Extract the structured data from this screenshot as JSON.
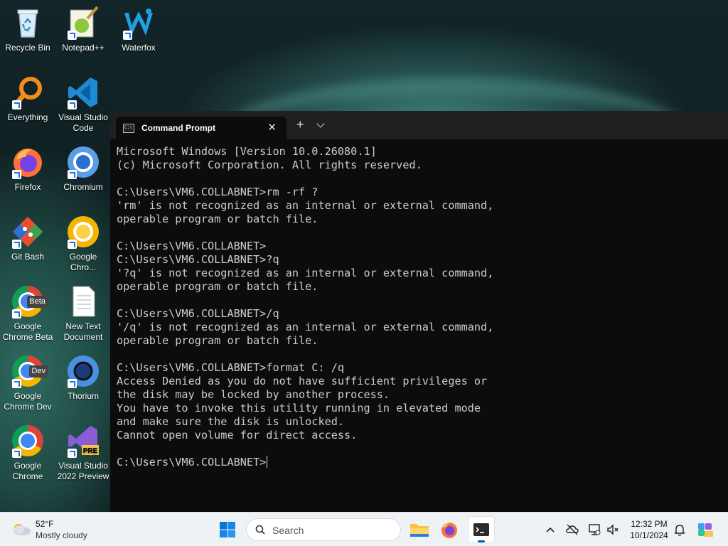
{
  "desktop": {
    "icons": [
      {
        "label": "Recycle Bin"
      },
      {
        "label": "Notepad++"
      },
      {
        "label": "Waterfox"
      },
      {
        "label": "Everything"
      },
      {
        "label": "Visual Studio Code"
      },
      {
        "label": "Firefox"
      },
      {
        "label": "Chromium"
      },
      {
        "label": "Git Bash"
      },
      {
        "label": "Google Chro..."
      },
      {
        "label": "Google Chrome Beta",
        "badge": "Beta"
      },
      {
        "label": "New Text Document"
      },
      {
        "label": "Google Chrome Dev",
        "badge": "Dev"
      },
      {
        "label": "Thorium"
      },
      {
        "label": "Google Chrome"
      },
      {
        "label": "Visual Studio 2022 Preview",
        "badge": "PRE"
      }
    ]
  },
  "terminal": {
    "tab_title": "Command Prompt",
    "close_glyph": "✕",
    "new_tab_glyph": "+",
    "lines": [
      "Microsoft Windows [Version 10.0.26080.1]",
      "(c) Microsoft Corporation. All rights reserved.",
      "",
      "C:\\Users\\VM6.COLLABNET>rm -rf ?",
      "'rm' is not recognized as an internal or external command,",
      "operable program or batch file.",
      "",
      "C:\\Users\\VM6.COLLABNET>",
      "C:\\Users\\VM6.COLLABNET>?q",
      "'?q' is not recognized as an internal or external command,",
      "operable program or batch file.",
      "",
      "C:\\Users\\VM6.COLLABNET>/q",
      "'/q' is not recognized as an internal or external command,",
      "operable program or batch file.",
      "",
      "C:\\Users\\VM6.COLLABNET>format C: /q",
      "Access Denied as you do not have sufficient privileges or",
      "the disk may be locked by another process.",
      "You have to invoke this utility running in elevated mode",
      "and make sure the disk is unlocked.",
      "Cannot open volume for direct access.",
      ""
    ],
    "prompt": "C:\\Users\\VM6.COLLABNET>"
  },
  "taskbar": {
    "weather_temp": "52°F",
    "weather_condition": "Mostly cloudy",
    "search_placeholder": "Search",
    "time": "12:32 PM",
    "date": "10/1/2024"
  },
  "colors": {
    "terminal_bg": "#0c0c0c",
    "terminal_text": "#cccccc",
    "taskbar_bg": "#eef2f5",
    "accent": "#005fb8"
  }
}
